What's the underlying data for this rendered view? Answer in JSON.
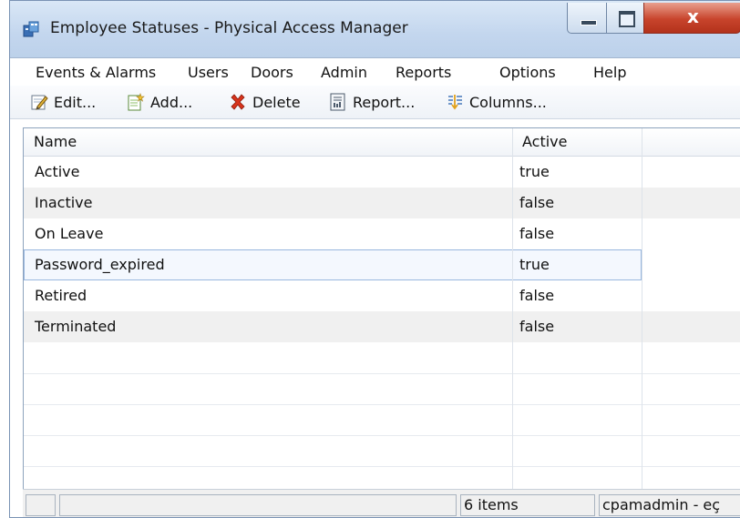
{
  "window": {
    "title": "Employee Statuses - Physical Access Manager",
    "close_glyph": "x"
  },
  "menubar": {
    "items": [
      "Events & Alarms",
      "Users",
      "Doors",
      "Admin",
      "Reports",
      "Options",
      "Help"
    ]
  },
  "toolbar": {
    "buttons": [
      {
        "label": "Edit...",
        "icon": "edit-icon"
      },
      {
        "label": "Add...",
        "icon": "add-icon"
      },
      {
        "label": "Delete",
        "icon": "delete-icon"
      },
      {
        "label": "Report...",
        "icon": "report-icon"
      },
      {
        "label": "Columns...",
        "icon": "columns-icon"
      }
    ]
  },
  "table": {
    "columns": [
      "Name",
      "Active"
    ],
    "rows": [
      {
        "name": "Active",
        "active": "true"
      },
      {
        "name": "Inactive",
        "active": "false"
      },
      {
        "name": "On Leave",
        "active": "false"
      },
      {
        "name": "Password_expired",
        "active": "true",
        "selected": true
      },
      {
        "name": "Retired",
        "active": "false"
      },
      {
        "name": "Terminated",
        "active": "false"
      }
    ]
  },
  "statusbar": {
    "count": "6 items",
    "user": "cpamadmin - eç"
  },
  "colors": {
    "title_bg": "#c3d6ee",
    "close_button": "#c8442c",
    "selection_border": "#98b7de",
    "alt_row": "#f0f0f0"
  }
}
